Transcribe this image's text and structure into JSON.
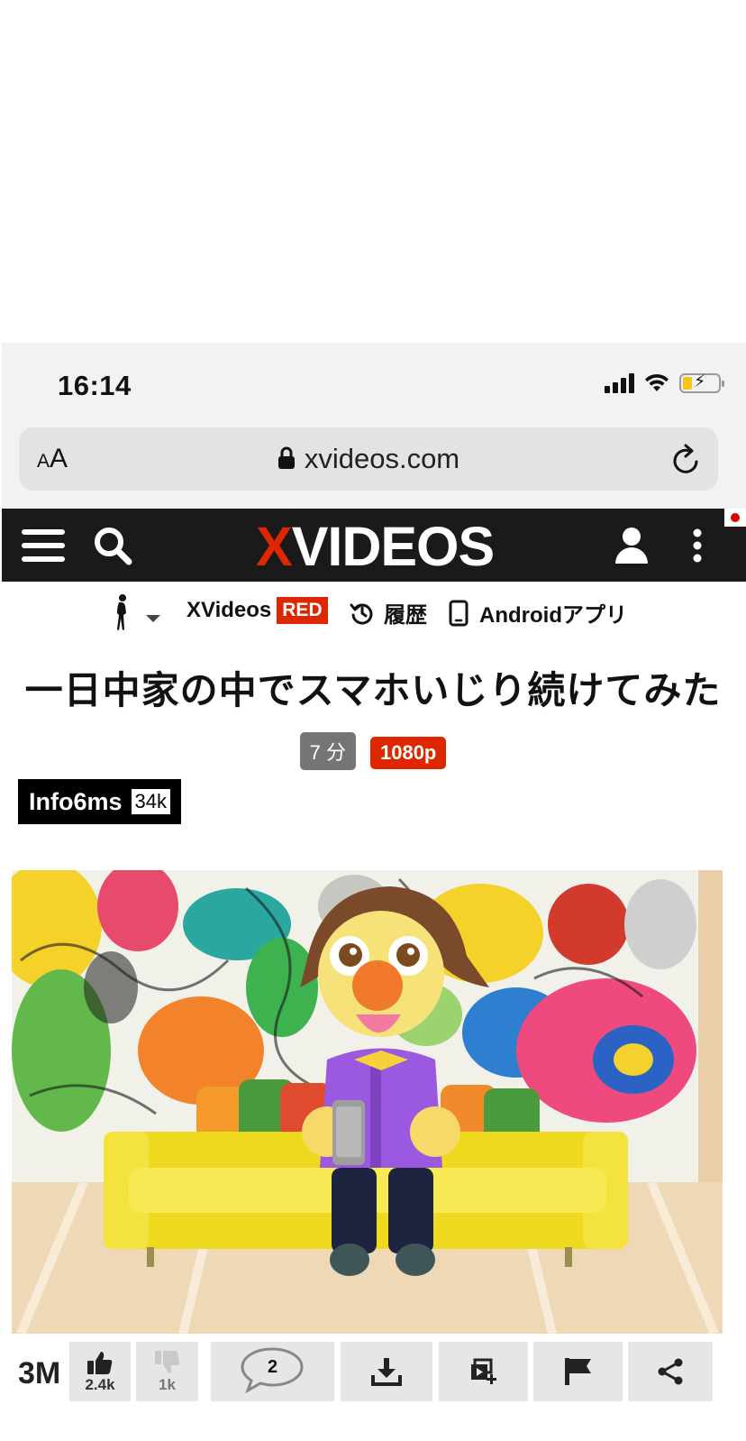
{
  "status_bar": {
    "time": "16:14"
  },
  "browser": {
    "text_size_label": "AA",
    "url": "xvideos.com"
  },
  "header": {
    "logo_x": "X",
    "logo_rest": "VIDEOS"
  },
  "subnav": {
    "red_prefix": "XVideos",
    "red_badge": "RED",
    "history": "履歴",
    "android_app": "Androidアプリ"
  },
  "video": {
    "title": "一日中家の中でスマホいじり続けてみた",
    "duration": "7 分",
    "quality": "1080p"
  },
  "uploader": {
    "name": "Info6ms",
    "subscribers": "34k"
  },
  "actions": {
    "views": "3M",
    "likes": "2.4k",
    "dislikes": "1k",
    "comments": "2"
  },
  "colors": {
    "brand_red": "#de2600",
    "header_bg": "#1a1a1a",
    "sofa": "#f2e22a",
    "shirt": "#9b59e0"
  }
}
